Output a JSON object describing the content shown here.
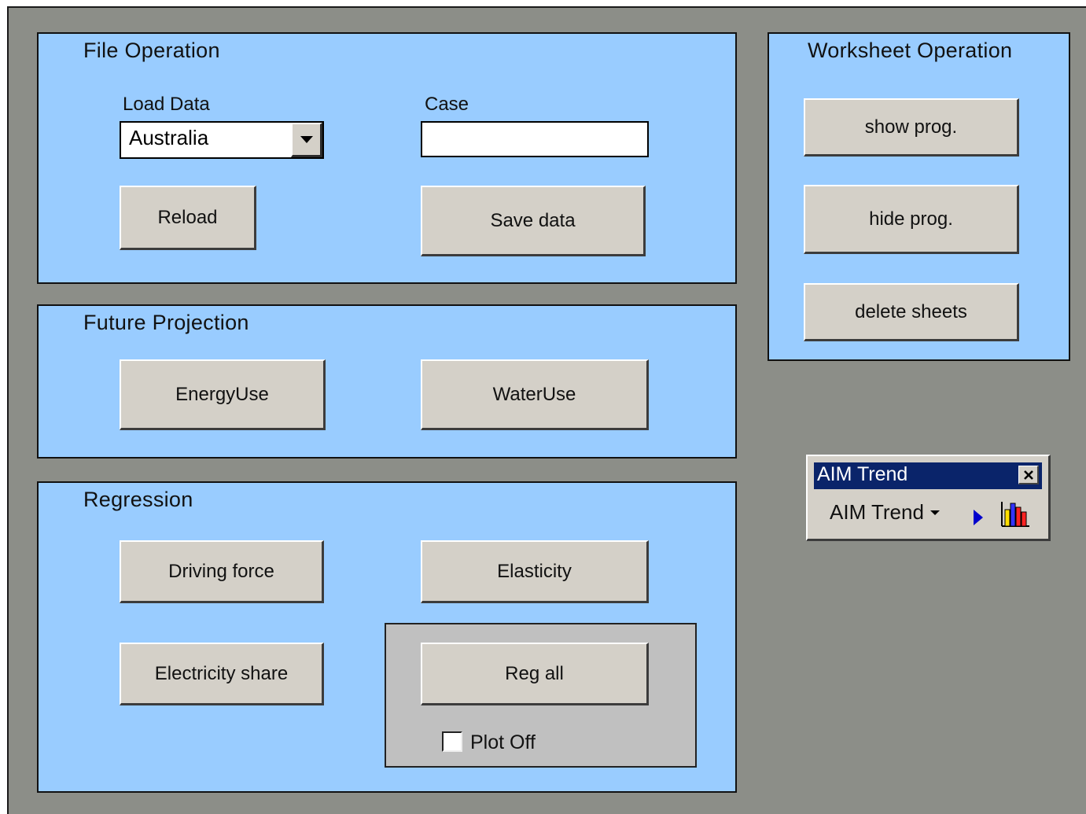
{
  "file_operation": {
    "title": "File Operation",
    "load_data_label": "Load Data",
    "load_data_value": "Australia",
    "case_label": "Case",
    "case_value": "",
    "reload_label": "Reload",
    "save_label": "Save data"
  },
  "future_projection": {
    "title": "Future Projection",
    "energy_label": "EnergyUse",
    "water_label": "WaterUse"
  },
  "regression": {
    "title": "Regression",
    "driving_force_label": "Driving force",
    "elasticity_label": "Elasticity",
    "electricity_share_label": "Electricity share",
    "reg_all_label": "Reg all",
    "plot_off_label": "Plot Off",
    "plot_off_checked": false
  },
  "worksheet_operation": {
    "title": "Worksheet Operation",
    "show_prog_label": "show prog.",
    "hide_prog_label": "hide prog.",
    "delete_sheets_label": "delete sheets"
  },
  "toolbar": {
    "title": "AIM Trend",
    "menu_label": "AIM Trend",
    "icons": [
      "close-icon",
      "dropdown-arrow-icon",
      "play-arrow-icon",
      "bar-chart-icon"
    ]
  },
  "colors": {
    "sheet_background": "#8c8e88",
    "panel_background": "#99ccff",
    "button_face": "#d4d0c8",
    "titlebar": "#0a246a"
  }
}
